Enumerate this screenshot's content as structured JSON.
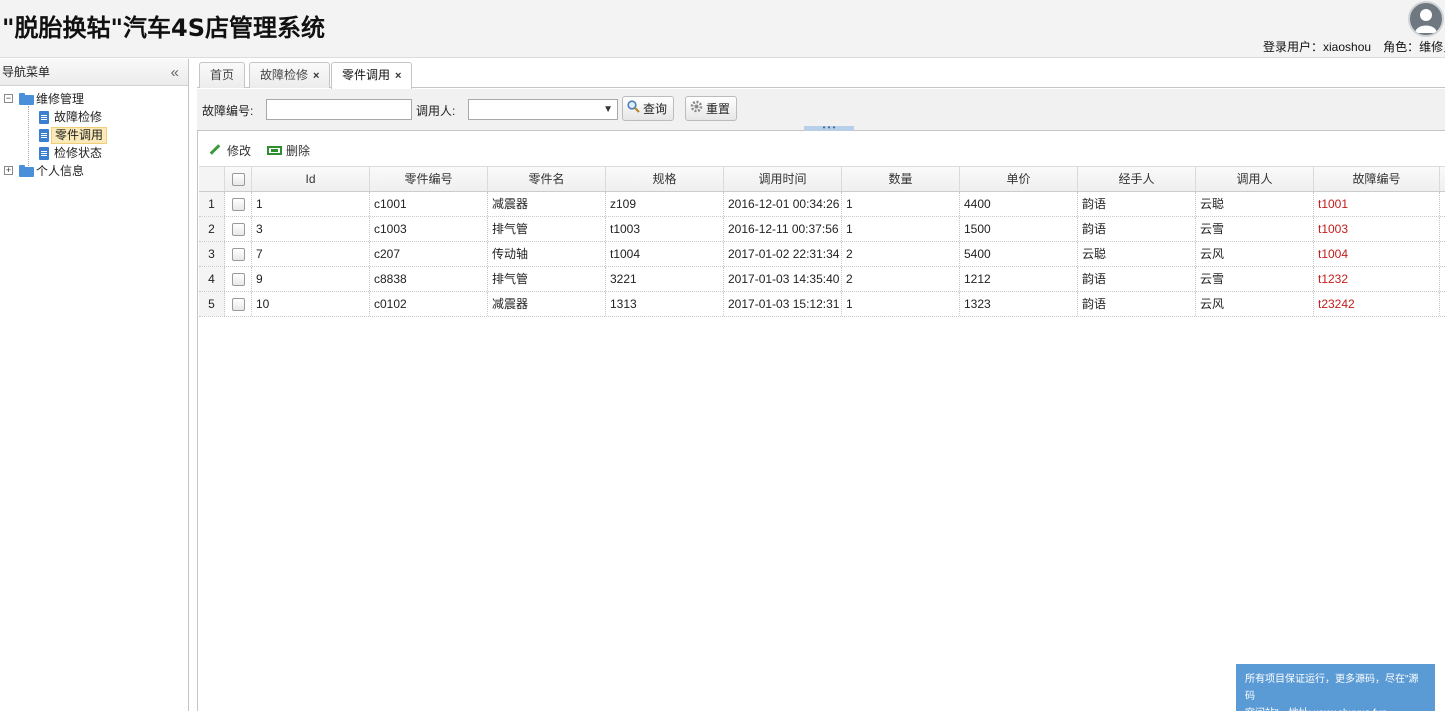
{
  "header": {
    "title": "\"脱胎换轱\"汽车4S店管理系统",
    "user_label": "登录用户：",
    "username": "xiaoshou",
    "role_label": "角色：",
    "role_value": "维修员"
  },
  "sidebar": {
    "title": "导航菜单",
    "collapse_glyph": "«",
    "tree": {
      "group1": "维修管理",
      "items": [
        "故障检修",
        "零件调用",
        "检修状态"
      ],
      "group2": "个人信息"
    }
  },
  "tabs": [
    "首页",
    "故障检修",
    "零件调用"
  ],
  "search": {
    "fault_no_label": "故障编号:",
    "fault_no_value": "",
    "caller_label": "调用人:",
    "caller_value": "",
    "query_button": "查询",
    "reset_button": "重置"
  },
  "toolbar": {
    "edit": "修改",
    "delete": "删除"
  },
  "table": {
    "columns": [
      "Id",
      "零件编号",
      "零件名",
      "规格",
      "调用时间",
      "数量",
      "单价",
      "经手人",
      "调用人",
      "故障编号"
    ],
    "rows": [
      {
        "n": "1",
        "id": "1",
        "part_no": "c1001",
        "part_name": "减震器",
        "spec": "z109",
        "time": "2016-12-01 00:34:26",
        "qty": "1",
        "price": "4400",
        "handler": "韵语",
        "caller": "云聪",
        "fault_no": "t1001"
      },
      {
        "n": "2",
        "id": "3",
        "part_no": "c1003",
        "part_name": "排气管",
        "spec": "t1003",
        "time": "2016-12-11 00:37:56",
        "qty": "1",
        "price": "1500",
        "handler": "韵语",
        "caller": "云雪",
        "fault_no": "t1003"
      },
      {
        "n": "3",
        "id": "7",
        "part_no": "c207",
        "part_name": "传动轴",
        "spec": "t1004",
        "time": "2017-01-02 22:31:34",
        "qty": "2",
        "price": "5400",
        "handler": "云聪",
        "caller": "云风",
        "fault_no": "t1004"
      },
      {
        "n": "4",
        "id": "9",
        "part_no": "c8838",
        "part_name": "排气管",
        "spec": "3221",
        "time": "2017-01-03 14:35:40",
        "qty": "2",
        "price": "1212",
        "handler": "韵语",
        "caller": "云雪",
        "fault_no": "t1232"
      },
      {
        "n": "5",
        "id": "10",
        "part_no": "c0102",
        "part_name": "减震器",
        "spec": "1313",
        "time": "2017-01-03 15:12:31",
        "qty": "1",
        "price": "1323",
        "handler": "韵语",
        "caller": "云风",
        "fault_no": "t23242"
      }
    ]
  },
  "ad": {
    "line1": "所有项目保证运行，更多源码，尽在\"源码",
    "line2": "空间站\"，地址: www.shuyue.fun"
  },
  "colors": {
    "fault_no_text": "#c21c1c",
    "ad_background": "#5b9bd5",
    "tree_selected": "#fbe9b7"
  }
}
